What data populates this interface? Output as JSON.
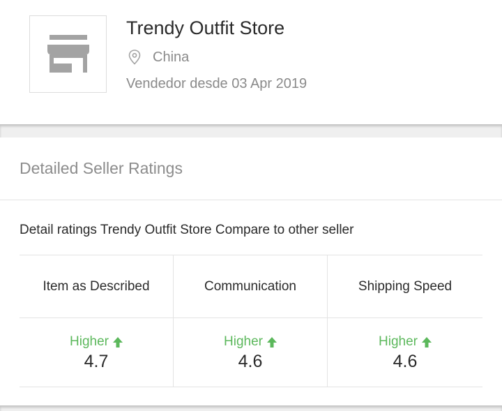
{
  "store": {
    "name": "Trendy Outfit Store",
    "location": "China",
    "seller_since": "Vendedor desde 03 Apr 2019",
    "logo_icon": "storefront-icon",
    "location_icon": "map-pin-icon"
  },
  "ratings_section": {
    "title": "Detailed Seller Ratings",
    "caption": "Detail ratings Trendy Outfit Store Compare to other seller",
    "columns": [
      {
        "label": "Item as Described",
        "trend": "Higher",
        "trend_icon": "arrow-up-icon",
        "score": "4.7"
      },
      {
        "label": "Communication",
        "trend": "Higher",
        "trend_icon": "arrow-up-icon",
        "score": "4.6"
      },
      {
        "label": "Shipping Speed",
        "trend": "Higher",
        "trend_icon": "arrow-up-icon",
        "score": "4.6"
      }
    ]
  },
  "colors": {
    "trend_green": "#5cb85c",
    "muted_text": "#8a8a8a",
    "logo_gray": "#a3a3a3"
  }
}
